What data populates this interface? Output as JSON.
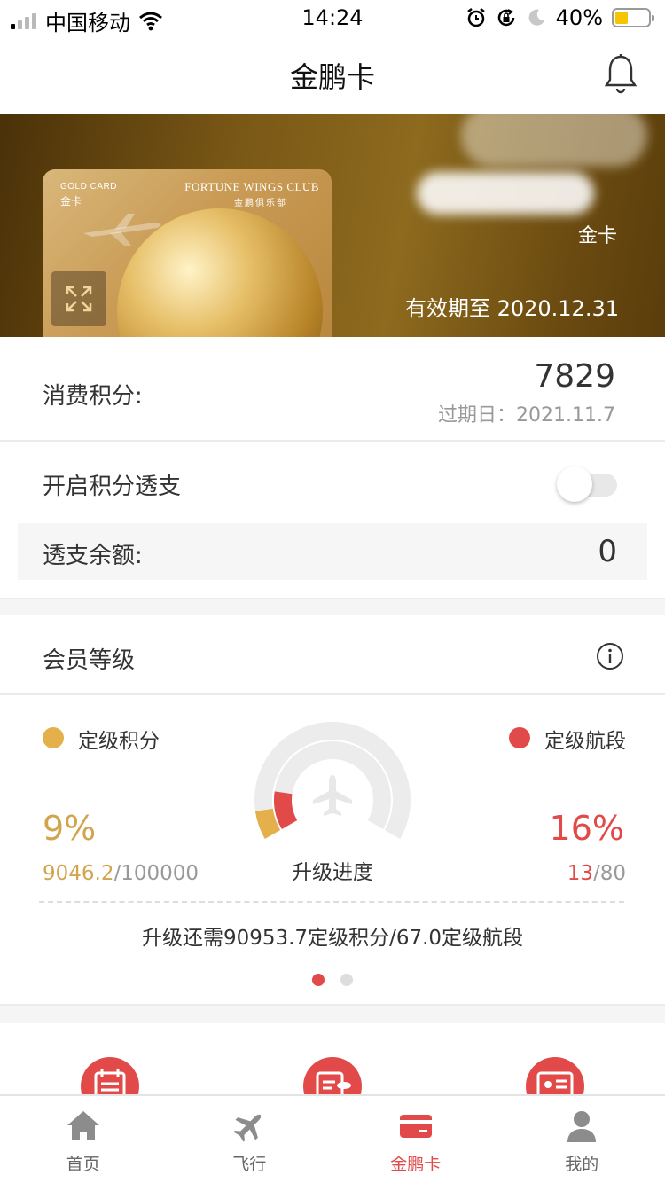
{
  "status_bar": {
    "carrier": "中国移动",
    "time": "14:24",
    "battery_percent": "40%",
    "battery_level": 0.4,
    "signal_bars": 1,
    "battery_color": "#f4c500"
  },
  "nav": {
    "title": "金鹏卡"
  },
  "card": {
    "tier_en": "GOLD CARD",
    "tier_cn": "金卡",
    "club_en": "FORTUNE WINGS CLUB",
    "club_cn": "金鹏俱乐部",
    "level": "金卡",
    "expiry": "有效期至 2020.12.31"
  },
  "points": {
    "label": "消费积分:",
    "value": "7829",
    "expiry": "过期日：2021.11.7"
  },
  "overdraft": {
    "label": "开启积分透支",
    "enabled": false,
    "balance_label": "透支余额:",
    "balance_value": "0"
  },
  "membership": {
    "label": "会员等级",
    "points_legend": "定级积分",
    "segments_legend": "定级航段",
    "points_percent": "9%",
    "points_fraction": 0.09,
    "points_current": "9046.2",
    "points_total": "/100000",
    "segments_percent": "16%",
    "segments_fraction": 0.16,
    "segments_current": "13",
    "segments_total": "/80",
    "gauge_label": "升级进度",
    "upgrade_need": "升级还需90953.7定级积分/67.0定级航段",
    "page_count": 2,
    "active_page": 0
  },
  "colors": {
    "accent_red": "#e24a4a",
    "accent_gold": "#e3b04b",
    "banner_brown": "#7a5816"
  },
  "tabs": [
    {
      "label": "首页",
      "icon": "home-icon",
      "active": false
    },
    {
      "label": "飞行",
      "icon": "plane-icon",
      "active": false
    },
    {
      "label": "金鹏卡",
      "icon": "card-icon",
      "active": true
    },
    {
      "label": "我的",
      "icon": "person-icon",
      "active": false
    }
  ]
}
